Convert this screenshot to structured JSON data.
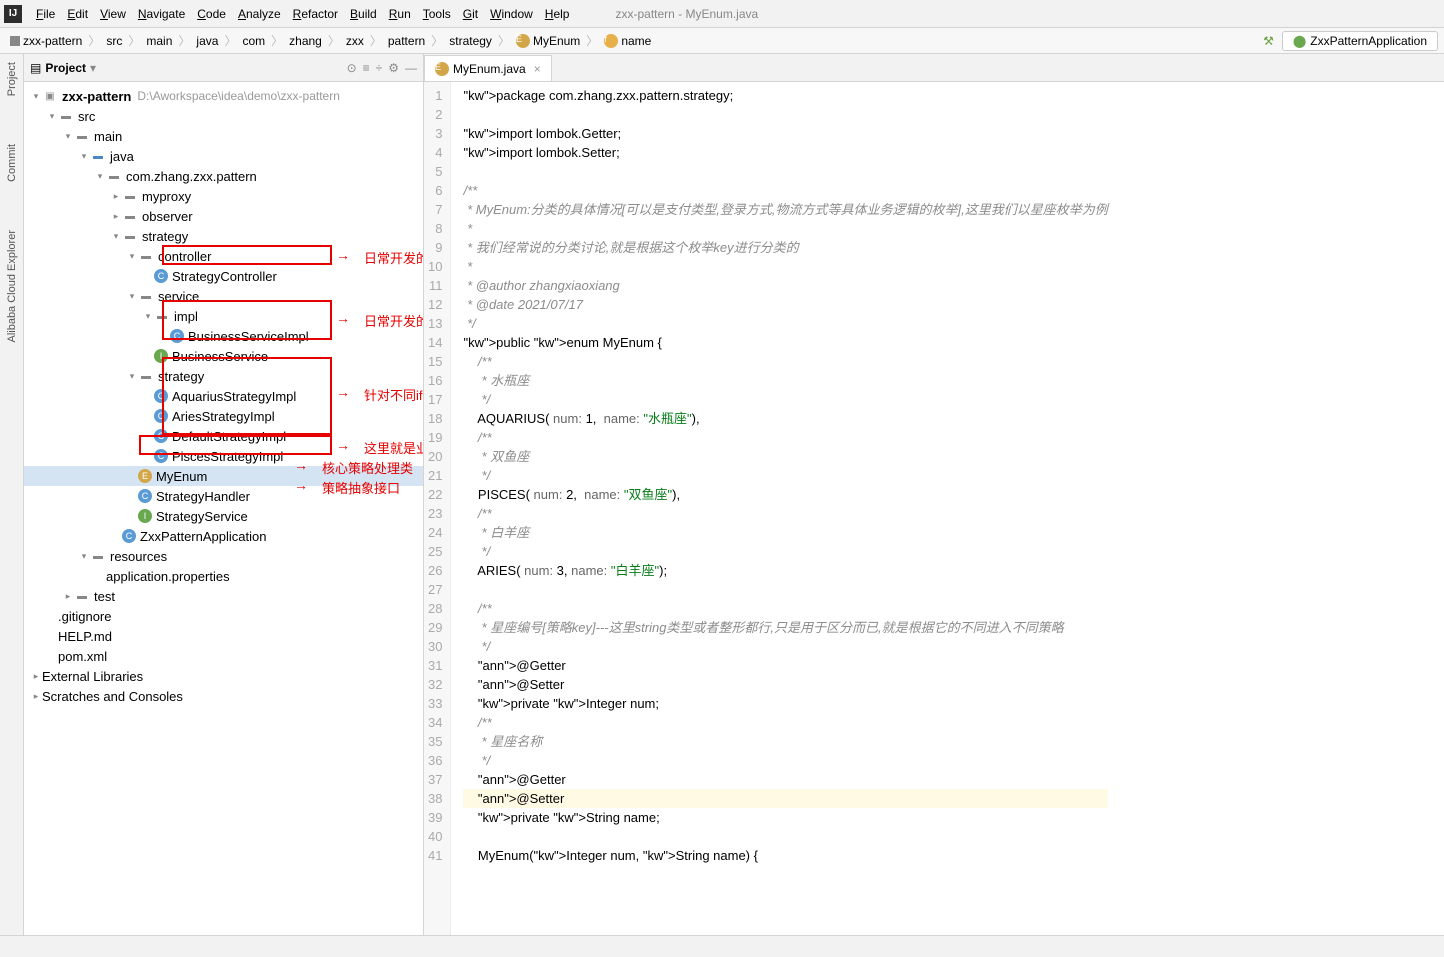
{
  "window_title": "zxx-pattern - MyEnum.java",
  "menu": [
    "File",
    "Edit",
    "View",
    "Navigate",
    "Code",
    "Analyze",
    "Refactor",
    "Build",
    "Run",
    "Tools",
    "Git",
    "Window",
    "Help"
  ],
  "breadcrumbs": [
    "zxx-pattern",
    "src",
    "main",
    "java",
    "com",
    "zhang",
    "zxx",
    "pattern",
    "strategy",
    "MyEnum",
    "name"
  ],
  "run_config": "ZxxPatternApplication",
  "left_tabs": [
    "Project",
    "Commit",
    "Alibaba Cloud Explorer"
  ],
  "project_label": "Project",
  "tree": {
    "root": "zxx-pattern",
    "root_hint": "D:\\Aworkspace\\idea\\demo\\zxx-pattern",
    "src": "src",
    "main": "main",
    "java": "java",
    "pkg": "com.zhang.zxx.pattern",
    "myproxy": "myproxy",
    "observer": "observer",
    "strategy": "strategy",
    "controller": "controller",
    "StrategyController": "StrategyController",
    "service": "service",
    "impl": "impl",
    "BusinessServiceImpl": "BusinessServiceImpl",
    "BusinessService": "BusinessService",
    "strategy2": "strategy",
    "AquariusStrategyImpl": "AquariusStrategyImpl",
    "AriesStrategyImpl": "AriesStrategyImpl",
    "DefaultStrategyImpl": "DefaultStrategyImpl",
    "PiscesStrategyImpl": "PiscesStrategyImpl",
    "MyEnum": "MyEnum",
    "StrategyHandler": "StrategyHandler",
    "StrategyService": "StrategyService",
    "ZxxPatternApplication": "ZxxPatternApplication",
    "resources": "resources",
    "appprops": "application.properties",
    "test": "test",
    "gitignore": ".gitignore",
    "help": "HELP.md",
    "pom": "pom.xml",
    "extlib": "External Libraries",
    "scratches": "Scratches and Consoles"
  },
  "annotations": {
    "a1": "日常开发的控制层",
    "a2": "日常开发的业务层",
    "a3": "针对不同if else分支抽象出来的策略实现类,需要新增或者修改策略就在这里操作",
    "a4": "这里就是业务类型的枚举,支付方式的枚举,登录方式的枚举,物流方式的枚举等等",
    "a5": "核心策略处理类",
    "a6": "策略抽象接口"
  },
  "tab": {
    "file": "MyEnum.java"
  },
  "code_lines": [
    "package com.zhang.zxx.pattern.strategy;",
    "",
    "import lombok.Getter;",
    "import lombok.Setter;",
    "",
    "/**",
    " * MyEnum:分类的具体情况[可以是支付类型,登录方式,物流方式等具体业务逻辑的枚举],这里我们以星座枚举为例",
    " *",
    " * 我们经常说的分类讨论,就是根据这个枚举key进行分类的",
    " *",
    " * @author zhangxiaoxiang",
    " * @date 2021/07/17",
    " */",
    "public enum MyEnum {",
    "    /**",
    "     * 水瓶座",
    "     */",
    "    AQUARIUS( num: 1,  name: \"水瓶座\"),",
    "    /**",
    "     * 双鱼座",
    "     */",
    "    PISCES( num: 2,  name: \"双鱼座\"),",
    "    /**",
    "     * 白羊座",
    "     */",
    "    ARIES( num: 3, name: \"白羊座\");",
    "",
    "    /**",
    "     * 星座编号[策略key]---这里string类型或者整形都行,只是用于区分而已,就是根据它的不同进入不同策略",
    "     */",
    "    @Getter",
    "    @Setter",
    "    private Integer num;",
    "    /**",
    "     * 星座名称",
    "     */",
    "    @Getter",
    "    @Setter",
    "    private String name;",
    "",
    "    MyEnum(Integer num, String name) {"
  ],
  "first_line_number": 1
}
